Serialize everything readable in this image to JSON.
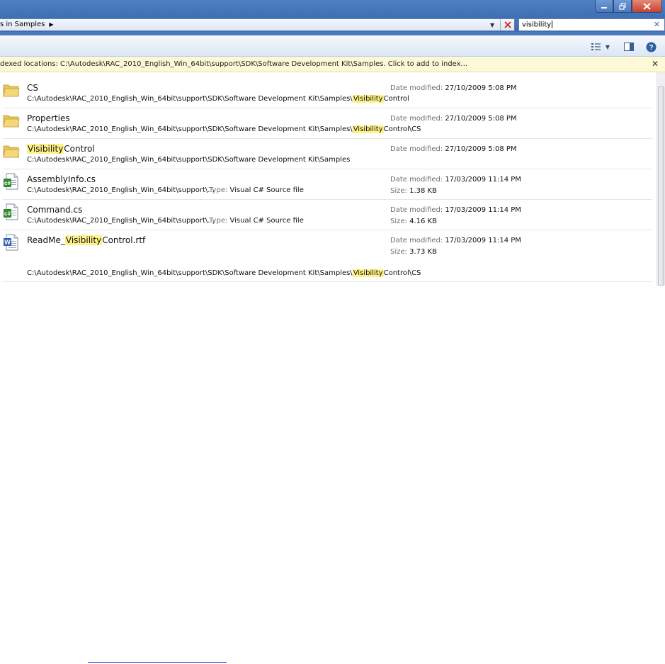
{
  "window": {
    "caption_buttons": {
      "minimize_icon": "minimize-icon",
      "maximize_icon": "restore-icon",
      "close_icon": "close-icon"
    }
  },
  "address_bar": {
    "breadcrumb": "s in Samples",
    "search_value": "visibility"
  },
  "info_bar": {
    "text": "dexed locations: C:\\Autodesk\\RAC_2010_English_Win_64bit\\support\\SDK\\Software Development Kit\\Samples. Click to add to index..."
  },
  "labels": {
    "date_modified": "Date modified:",
    "size": "Size:",
    "type": "Type:"
  },
  "results": [
    {
      "icon": "folder-icon",
      "name_parts": [
        "CS",
        "",
        ""
      ],
      "path_parts": [
        "C:\\Autodesk\\RAC_2010_English_Win_64bit\\support\\SDK\\Software Development Kit\\Samples\\",
        "Visibility",
        "Control"
      ],
      "date": "27/10/2009 5:08 PM"
    },
    {
      "icon": "folder-icon",
      "name_parts": [
        "Properties",
        "",
        ""
      ],
      "path_parts": [
        "C:\\Autodesk\\RAC_2010_English_Win_64bit\\support\\SDK\\Software Development Kit\\Samples\\",
        "Visibility",
        "Control\\CS"
      ],
      "date": "27/10/2009 5:08 PM"
    },
    {
      "icon": "folder-icon",
      "name_parts": [
        "",
        "Visibility",
        "Control"
      ],
      "path_parts": [
        "C:\\Autodesk\\RAC_2010_English_Win_64bit\\support\\SDK\\Software Development Kit\\Samples",
        "",
        ""
      ],
      "date": "27/10/2009 5:08 PM"
    },
    {
      "icon": "csharp-file-icon",
      "name_parts": [
        "AssemblyInfo.cs",
        "",
        ""
      ],
      "path_parts": [
        "C:\\Autodesk\\RAC_2010_English_Win_64bit\\support\\...",
        "",
        ""
      ],
      "type": "Visual C# Source file",
      "date": "17/03/2009 11:14 PM",
      "size": "1.38 KB"
    },
    {
      "icon": "csharp-file-icon",
      "name_parts": [
        "Command.cs",
        "",
        ""
      ],
      "path_parts": [
        "C:\\Autodesk\\RAC_2010_English_Win_64bit\\support\\...",
        "",
        ""
      ],
      "type": "Visual C# Source file",
      "date": "17/03/2009 11:14 PM",
      "size": "4.16 KB"
    },
    {
      "icon": "word-document-icon",
      "name_parts": [
        "ReadMe_",
        "Visibility",
        "Control.rtf"
      ],
      "path_parts": [
        "C:\\Autodesk\\RAC_2010_English_Win_64bit\\support\\SDK\\Software Development Kit\\Samples\\",
        "Visibility",
        "Control\\CS"
      ],
      "date": "17/03/2009 11:14 PM",
      "size": "3.73 KB"
    }
  ]
}
